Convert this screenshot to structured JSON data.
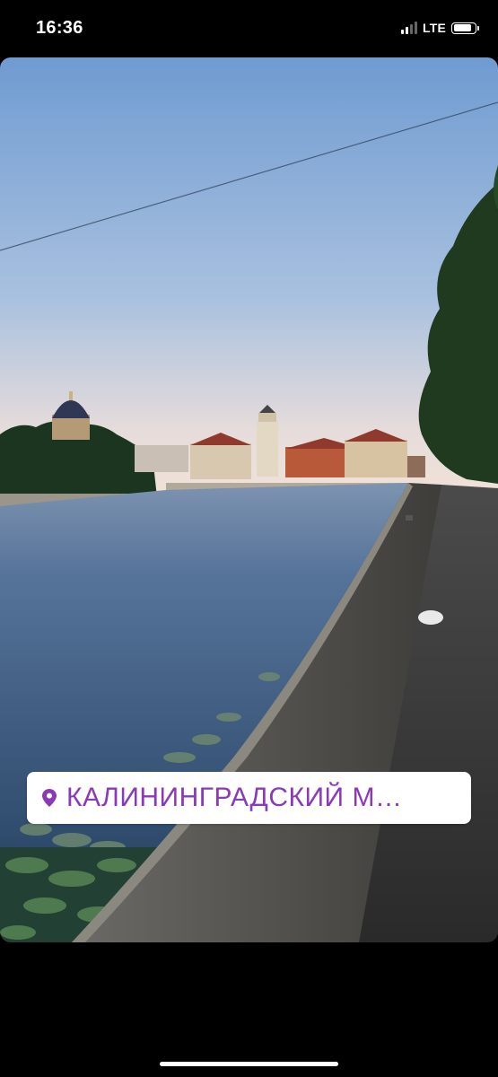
{
  "status_bar": {
    "time": "16:36",
    "network": "LTE",
    "battery_icon": "battery-icon",
    "signal_icon": "cellular-signal-icon"
  },
  "story": {
    "image_description_icon": "photo",
    "location_sticker": {
      "icon": "location-pin-icon",
      "text": "КАЛИНИНГРАДСКИЙ М…",
      "text_color": "#8a3ab9",
      "background": "#ffffff"
    }
  },
  "colors": {
    "sky_top": "#6f9bd1",
    "sky_bottom": "#f1e2d6",
    "water": "#3f5f86",
    "trees": "#1f3a1f"
  }
}
